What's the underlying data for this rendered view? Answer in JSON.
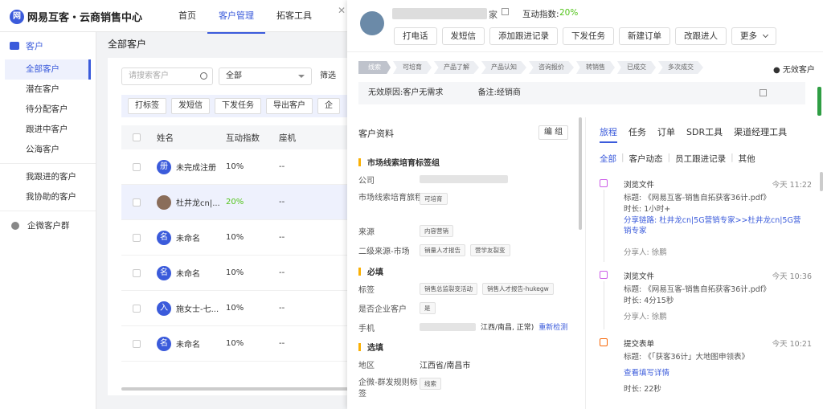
{
  "app": {
    "brand": "网易互客・云商销售中心",
    "logo_glyph": "网"
  },
  "nav": [
    {
      "label": "首页"
    },
    {
      "label": "客户管理",
      "active": true
    },
    {
      "label": "拓客工具"
    }
  ],
  "sidebar": {
    "header": "客户",
    "items": [
      "全部客户",
      "潜在客户",
      "待分配客户",
      "跟进中客户",
      "公海客户"
    ],
    "items2": [
      "我跟进的客户",
      "我协助的客户"
    ],
    "group": "企微客户群"
  },
  "list": {
    "title": "全部客户",
    "search_placeholder": "请搜索客户",
    "select_value": "全部",
    "filter": "筛选",
    "actions": [
      "打标签",
      "发短信",
      "下发任务",
      "导出客户",
      "企"
    ],
    "columns": [
      "姓名",
      "互动指数",
      "座机"
    ],
    "rows": [
      {
        "avatar": "册",
        "name": "未完成注册",
        "score": "10%",
        "phone": "--"
      },
      {
        "avatar": "",
        "name": "杜井龙cn|...",
        "score": "20%",
        "phone": "--",
        "highlight": true
      },
      {
        "avatar": "名",
        "name": "未命名",
        "score": "10%",
        "phone": "--"
      },
      {
        "avatar": "名",
        "name": "未命名",
        "score": "10%",
        "phone": "--"
      },
      {
        "avatar": "入",
        "name": "施女士-七...",
        "score": "10%",
        "phone": "--"
      },
      {
        "avatar": "名",
        "name": "未命名",
        "score": "10%",
        "phone": "--"
      }
    ]
  },
  "drawer": {
    "name_suffix": "家",
    "score_label": "互动指数:",
    "score_value": "20%",
    "buttons": [
      "打电话",
      "发短信",
      "添加跟进记录",
      "下发任务",
      "新建订单",
      "改跟进人",
      "更多"
    ],
    "stages": [
      "线索",
      "可培育",
      "产品了解",
      "产品认知",
      "咨询报价",
      "转销售",
      "已成交",
      "多次成交"
    ],
    "invalid": "● 无效客户",
    "reason": {
      "reason": "无效原因:客户无需求",
      "note": "备注:经销商"
    },
    "info": {
      "title": "客户资料",
      "edit": "编 组",
      "section1": "市场线索培育标签组",
      "company_label": "公司",
      "stage_label": "市场线索培育旅程",
      "stage_tag": "可培育",
      "source_label": "来源",
      "source_tag": "内容营销",
      "source2_label": "二级来源-市场",
      "source2_tags": [
        "销量人才报告",
        "营学友裂变"
      ],
      "section2": "必填",
      "tag_label": "标签",
      "tags": [
        "销售总监裂变活动",
        "销售人才报告-hukegw"
      ],
      "wechat_label": "是否企业客户",
      "wechat_tag": "是",
      "phone_label": "手机",
      "phone_val": "江西/南昌, 正常)",
      "recheck": "重新检测",
      "section3": "选填",
      "region_label": "地区",
      "region_val": "江西省/南昌市",
      "rule_label": "企微-群发规则标签",
      "rule_tag": "线索"
    },
    "tabs": [
      "旅程",
      "任务",
      "订单",
      "SDR工具",
      "渠道经理工具"
    ],
    "subtabs": [
      "全部",
      "客户动态",
      "员工跟进记录",
      "其他"
    ],
    "events": [
      {
        "title": "浏览文件",
        "time": "今天 11:22",
        "lines": [
          "标题: 《网易互客-销售自拓获客36计.pdf》",
          "时长: 1小时+",
          "分享链路: 杜井龙cn|5G营销专家>>杜井龙cn|5G营销专家",
          "分享人: 徐鹏"
        ]
      },
      {
        "title": "浏览文件",
        "time": "今天 10:36",
        "lines": [
          "标题: 《网易互客-销售自拓获客36计.pdf》",
          "时长: 4分15秒",
          "分享人: 徐鹏"
        ]
      },
      {
        "title": "提交表单",
        "time": "今天 10:21",
        "lines": [
          "标题: 《「获客36计」大地图申领表》",
          "查看填写详情",
          "时长: 22秒"
        ]
      }
    ]
  }
}
